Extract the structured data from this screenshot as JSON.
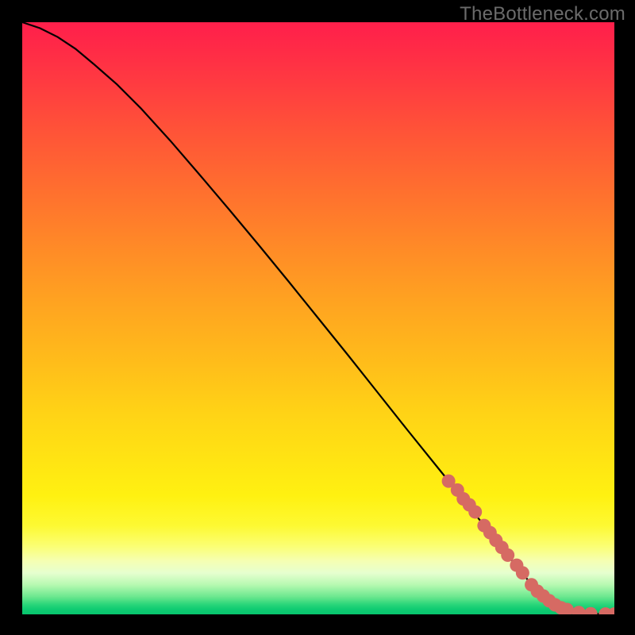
{
  "watermark": "TheBottleneck.com",
  "colors": {
    "curve": "#000000",
    "marker_fill": "#d66a63",
    "marker_stroke": "#b94f4b"
  },
  "chart_data": {
    "type": "line",
    "title": "",
    "xlabel": "",
    "ylabel": "",
    "xlim": [
      0,
      100
    ],
    "ylim": [
      0,
      100
    ],
    "grid": false,
    "legend": false,
    "series": [
      {
        "name": "bottleneck-curve",
        "x": [
          0,
          3,
          6,
          9,
          12,
          16,
          20,
          25,
          30,
          35,
          40,
          45,
          50,
          55,
          60,
          65,
          70,
          75,
          78,
          80,
          82,
          84,
          85,
          86,
          88,
          90,
          92,
          94,
          96,
          98,
          100
        ],
        "y": [
          100,
          99,
          97.5,
          95.5,
          93,
          89.5,
          85.5,
          80,
          74.2,
          68.3,
          62.3,
          56.2,
          50,
          43.8,
          37.5,
          31.2,
          25,
          18.8,
          15,
          12.5,
          10,
          7.5,
          6.3,
          5,
          3.1,
          1.6,
          0.8,
          0.3,
          0.1,
          0.05,
          0.05
        ]
      }
    ],
    "markers": {
      "name": "highlighted-points",
      "x": [
        72,
        73.5,
        74.5,
        75.5,
        76.5,
        78,
        79,
        80,
        81,
        82,
        83.5,
        84.5,
        86,
        87,
        88,
        89,
        90,
        91,
        92,
        94,
        96,
        98.5,
        100
      ],
      "y": [
        22.5,
        21,
        19.5,
        18.5,
        17.3,
        15,
        13.8,
        12.5,
        11.3,
        10,
        8.3,
        7,
        5,
        3.9,
        3.1,
        2.3,
        1.6,
        1.1,
        0.8,
        0.3,
        0.1,
        0.05,
        0.05
      ]
    }
  }
}
